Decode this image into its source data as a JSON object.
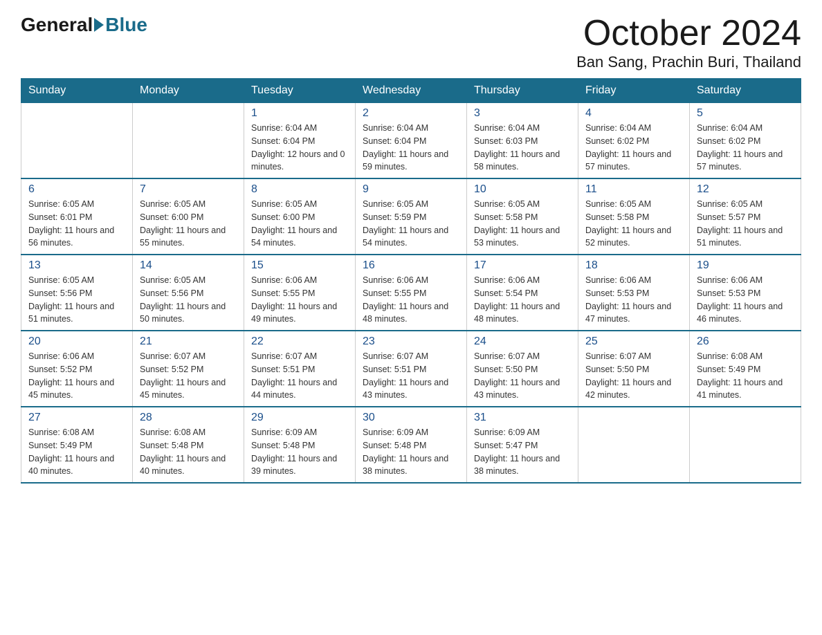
{
  "logo": {
    "general": "General",
    "blue": "Blue"
  },
  "title": "October 2024",
  "location": "Ban Sang, Prachin Buri, Thailand",
  "days_of_week": [
    "Sunday",
    "Monday",
    "Tuesday",
    "Wednesday",
    "Thursday",
    "Friday",
    "Saturday"
  ],
  "weeks": [
    [
      {
        "day": "",
        "info": ""
      },
      {
        "day": "",
        "info": ""
      },
      {
        "day": "1",
        "info": "Sunrise: 6:04 AM\nSunset: 6:04 PM\nDaylight: 12 hours\nand 0 minutes."
      },
      {
        "day": "2",
        "info": "Sunrise: 6:04 AM\nSunset: 6:04 PM\nDaylight: 11 hours\nand 59 minutes."
      },
      {
        "day": "3",
        "info": "Sunrise: 6:04 AM\nSunset: 6:03 PM\nDaylight: 11 hours\nand 58 minutes."
      },
      {
        "day": "4",
        "info": "Sunrise: 6:04 AM\nSunset: 6:02 PM\nDaylight: 11 hours\nand 57 minutes."
      },
      {
        "day": "5",
        "info": "Sunrise: 6:04 AM\nSunset: 6:02 PM\nDaylight: 11 hours\nand 57 minutes."
      }
    ],
    [
      {
        "day": "6",
        "info": "Sunrise: 6:05 AM\nSunset: 6:01 PM\nDaylight: 11 hours\nand 56 minutes."
      },
      {
        "day": "7",
        "info": "Sunrise: 6:05 AM\nSunset: 6:00 PM\nDaylight: 11 hours\nand 55 minutes."
      },
      {
        "day": "8",
        "info": "Sunrise: 6:05 AM\nSunset: 6:00 PM\nDaylight: 11 hours\nand 54 minutes."
      },
      {
        "day": "9",
        "info": "Sunrise: 6:05 AM\nSunset: 5:59 PM\nDaylight: 11 hours\nand 54 minutes."
      },
      {
        "day": "10",
        "info": "Sunrise: 6:05 AM\nSunset: 5:58 PM\nDaylight: 11 hours\nand 53 minutes."
      },
      {
        "day": "11",
        "info": "Sunrise: 6:05 AM\nSunset: 5:58 PM\nDaylight: 11 hours\nand 52 minutes."
      },
      {
        "day": "12",
        "info": "Sunrise: 6:05 AM\nSunset: 5:57 PM\nDaylight: 11 hours\nand 51 minutes."
      }
    ],
    [
      {
        "day": "13",
        "info": "Sunrise: 6:05 AM\nSunset: 5:56 PM\nDaylight: 11 hours\nand 51 minutes."
      },
      {
        "day": "14",
        "info": "Sunrise: 6:05 AM\nSunset: 5:56 PM\nDaylight: 11 hours\nand 50 minutes."
      },
      {
        "day": "15",
        "info": "Sunrise: 6:06 AM\nSunset: 5:55 PM\nDaylight: 11 hours\nand 49 minutes."
      },
      {
        "day": "16",
        "info": "Sunrise: 6:06 AM\nSunset: 5:55 PM\nDaylight: 11 hours\nand 48 minutes."
      },
      {
        "day": "17",
        "info": "Sunrise: 6:06 AM\nSunset: 5:54 PM\nDaylight: 11 hours\nand 48 minutes."
      },
      {
        "day": "18",
        "info": "Sunrise: 6:06 AM\nSunset: 5:53 PM\nDaylight: 11 hours\nand 47 minutes."
      },
      {
        "day": "19",
        "info": "Sunrise: 6:06 AM\nSunset: 5:53 PM\nDaylight: 11 hours\nand 46 minutes."
      }
    ],
    [
      {
        "day": "20",
        "info": "Sunrise: 6:06 AM\nSunset: 5:52 PM\nDaylight: 11 hours\nand 45 minutes."
      },
      {
        "day": "21",
        "info": "Sunrise: 6:07 AM\nSunset: 5:52 PM\nDaylight: 11 hours\nand 45 minutes."
      },
      {
        "day": "22",
        "info": "Sunrise: 6:07 AM\nSunset: 5:51 PM\nDaylight: 11 hours\nand 44 minutes."
      },
      {
        "day": "23",
        "info": "Sunrise: 6:07 AM\nSunset: 5:51 PM\nDaylight: 11 hours\nand 43 minutes."
      },
      {
        "day": "24",
        "info": "Sunrise: 6:07 AM\nSunset: 5:50 PM\nDaylight: 11 hours\nand 43 minutes."
      },
      {
        "day": "25",
        "info": "Sunrise: 6:07 AM\nSunset: 5:50 PM\nDaylight: 11 hours\nand 42 minutes."
      },
      {
        "day": "26",
        "info": "Sunrise: 6:08 AM\nSunset: 5:49 PM\nDaylight: 11 hours\nand 41 minutes."
      }
    ],
    [
      {
        "day": "27",
        "info": "Sunrise: 6:08 AM\nSunset: 5:49 PM\nDaylight: 11 hours\nand 40 minutes."
      },
      {
        "day": "28",
        "info": "Sunrise: 6:08 AM\nSunset: 5:48 PM\nDaylight: 11 hours\nand 40 minutes."
      },
      {
        "day": "29",
        "info": "Sunrise: 6:09 AM\nSunset: 5:48 PM\nDaylight: 11 hours\nand 39 minutes."
      },
      {
        "day": "30",
        "info": "Sunrise: 6:09 AM\nSunset: 5:48 PM\nDaylight: 11 hours\nand 38 minutes."
      },
      {
        "day": "31",
        "info": "Sunrise: 6:09 AM\nSunset: 5:47 PM\nDaylight: 11 hours\nand 38 minutes."
      },
      {
        "day": "",
        "info": ""
      },
      {
        "day": "",
        "info": ""
      }
    ]
  ]
}
